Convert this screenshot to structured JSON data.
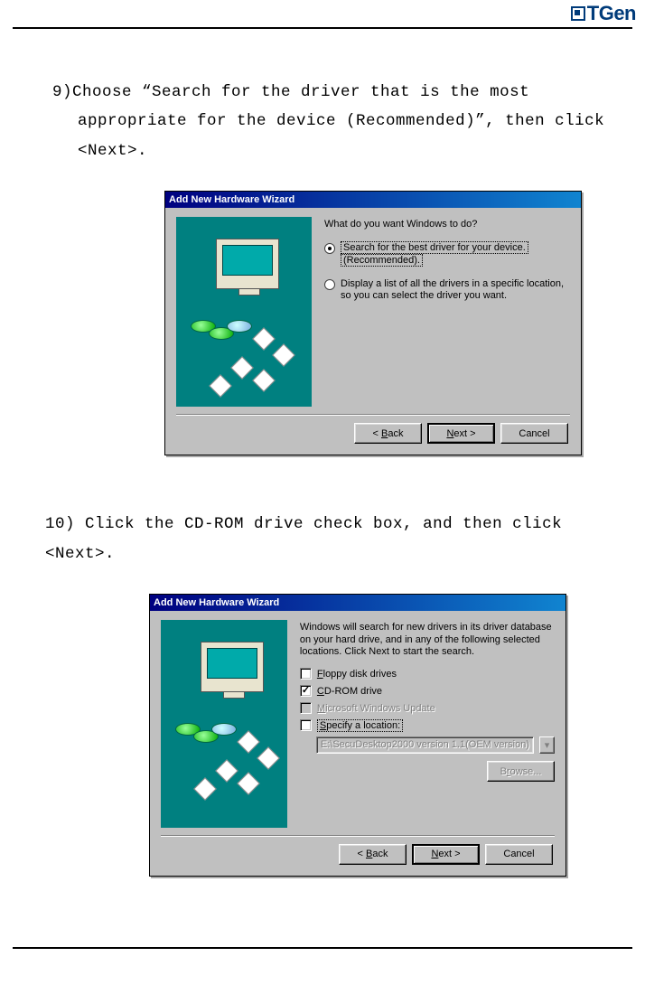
{
  "logo": {
    "text": "TGen"
  },
  "steps": {
    "s9": "9)Choose “Search for the driver that is the most appropriate for the device (Recommended)”, then click <Next>.",
    "s10": "10) Click the CD-ROM drive check box, and then click <Next>."
  },
  "dialog1": {
    "title": "Add New Hardware Wizard",
    "prompt": "What do you want Windows to do?",
    "opt1_a": "Search for the best driver for your device.",
    "opt1_b": "(Recommended).",
    "opt2": "Display a list of all the drivers in a specific location, so you can select the driver you want.",
    "back": "< Back",
    "next": "Next >",
    "cancel": "Cancel"
  },
  "dialog2": {
    "title": "Add New Hardware Wizard",
    "intro": "Windows will search for new drivers in its driver database on your hard drive, and in any of the following selected locations. Click Next to start the search.",
    "cb_floppy": "Floppy disk drives",
    "cb_cdrom": "CD-ROM drive",
    "cb_msupdate": "Microsoft Windows Update",
    "cb_specify": "Specify a location:",
    "path": "E:\\SecuDesktop2000 version 1.1(OEM version)",
    "browse": "Browse...",
    "back": "< Back",
    "next": "Next >",
    "cancel": "Cancel"
  }
}
